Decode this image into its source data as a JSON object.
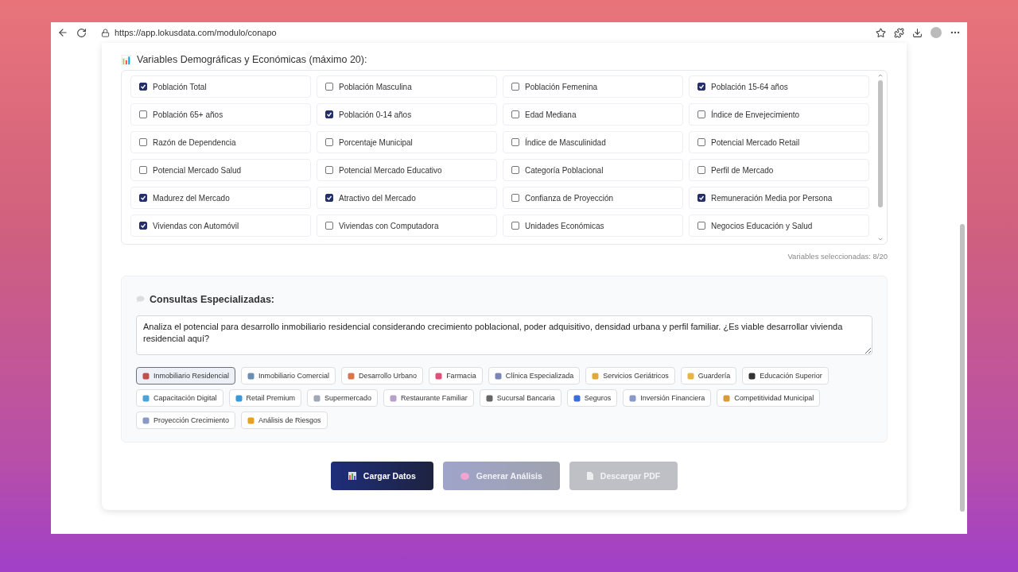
{
  "browser": {
    "url": "https://app.lokusdata.com/modulo/conapo"
  },
  "variables": {
    "icon": "📊",
    "title": "Variables Demográficas y Económicas (máximo 20):",
    "items": [
      {
        "label": "Población Total",
        "checked": true
      },
      {
        "label": "Población Masculina",
        "checked": false
      },
      {
        "label": "Población Femenina",
        "checked": false
      },
      {
        "label": "Población 15-64 años",
        "checked": true
      },
      {
        "label": "Población 65+ años",
        "checked": false
      },
      {
        "label": "Población 0-14 años",
        "checked": true
      },
      {
        "label": "Edad Mediana",
        "checked": false
      },
      {
        "label": "Índice de Envejecimiento",
        "checked": false
      },
      {
        "label": "Razón de Dependencia",
        "checked": false
      },
      {
        "label": "Porcentaje Municipal",
        "checked": false
      },
      {
        "label": "Índice de Masculinidad",
        "checked": false
      },
      {
        "label": "Potencial Mercado Retail",
        "checked": false
      },
      {
        "label": "Potencial Mercado Salud",
        "checked": false
      },
      {
        "label": "Potencial Mercado Educativo",
        "checked": false
      },
      {
        "label": "Categoría Poblacional",
        "checked": false
      },
      {
        "label": "Perfil de Mercado",
        "checked": false
      },
      {
        "label": "Madurez del Mercado",
        "checked": true
      },
      {
        "label": "Atractivo del Mercado",
        "checked": true
      },
      {
        "label": "Confianza de Proyección",
        "checked": false
      },
      {
        "label": "Remuneración Media por Persona",
        "checked": true
      },
      {
        "label": "Viviendas con Automóvil",
        "checked": true
      },
      {
        "label": "Viviendas con Computadora",
        "checked": false
      },
      {
        "label": "Unidades Económicas",
        "checked": false
      },
      {
        "label": "Negocios Educación y Salud",
        "checked": false
      }
    ],
    "counter": "Variables seleccionadas: 8/20"
  },
  "consultas": {
    "title": "Consultas Especializadas:",
    "query": "Analiza el potencial para desarrollo inmobiliario residencial considerando crecimiento poblacional, poder adquisitivo, densidad urbana y perfil familiar. ¿Es viable desarrollar vivienda residencial aquí?",
    "chips": [
      {
        "label": "Inmobiliario Residencial",
        "selected": true,
        "color": "#c0504d"
      },
      {
        "label": "Inmobiliario Comercial",
        "selected": false,
        "color": "#6b8fb3"
      },
      {
        "label": "Desarrollo Urbano",
        "selected": false,
        "color": "#d9774a"
      },
      {
        "label": "Farmacia",
        "selected": false,
        "color": "#e0507a"
      },
      {
        "label": "Clínica Especializada",
        "selected": false,
        "color": "#7a86b8"
      },
      {
        "label": "Servicios Geriátricos",
        "selected": false,
        "color": "#e0a93a"
      },
      {
        "label": "Guardería",
        "selected": false,
        "color": "#e8b540"
      },
      {
        "label": "Educación Superior",
        "selected": false,
        "color": "#333333"
      },
      {
        "label": "Capacitación Digital",
        "selected": false,
        "color": "#4aa3d9"
      },
      {
        "label": "Retail Premium",
        "selected": false,
        "color": "#3a9ad9"
      },
      {
        "label": "Supermercado",
        "selected": false,
        "color": "#a0a8b8"
      },
      {
        "label": "Restaurante Familiar",
        "selected": false,
        "color": "#b8a0c8"
      },
      {
        "label": "Sucursal Bancaria",
        "selected": false,
        "color": "#666666"
      },
      {
        "label": "Seguros",
        "selected": false,
        "color": "#3a6fd9"
      },
      {
        "label": "Inversión Financiera",
        "selected": false,
        "color": "#8a9ac8"
      },
      {
        "label": "Competitividad Municipal",
        "selected": false,
        "color": "#d99a3a"
      },
      {
        "label": "Proyección Crecimiento",
        "selected": false,
        "color": "#8a9ac8"
      },
      {
        "label": "Análisis de Riesgos",
        "selected": false,
        "color": "#e8a020"
      }
    ]
  },
  "actions": [
    {
      "label": "Cargar Datos",
      "kind": "load",
      "disabled": false
    },
    {
      "label": "Generar Análisis",
      "kind": "analyze",
      "disabled": true
    },
    {
      "label": "Descargar PDF",
      "kind": "pdf",
      "disabled": true
    }
  ]
}
